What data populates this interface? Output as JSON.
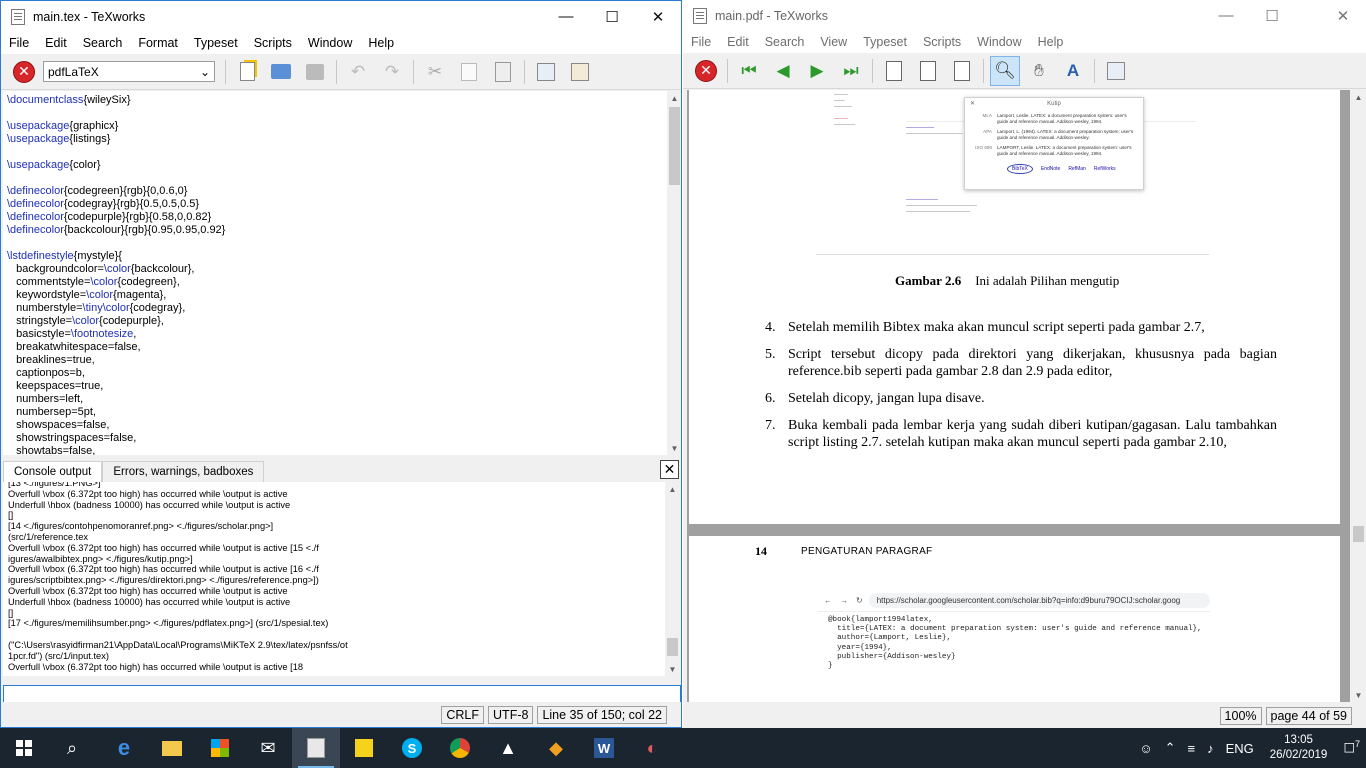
{
  "left_window": {
    "title": "main.tex - TeXworks",
    "menu": [
      "File",
      "Edit",
      "Search",
      "Format",
      "Typeset",
      "Scripts",
      "Window",
      "Help"
    ],
    "typeset_engine": "pdfLaTeX",
    "code_lines": [
      "\\documentclass{wileySix}",
      "",
      "\\usepackage{graphicx}",
      "\\usepackage{listings}",
      "",
      "\\usepackage{color}",
      "",
      "\\definecolor{codegreen}{rgb}{0,0.6,0}",
      "\\definecolor{codegray}{rgb}{0.5,0.5,0.5}",
      "\\definecolor{codepurple}{rgb}{0.58,0,0.82}",
      "\\definecolor{backcolour}{rgb}{0.95,0.95,0.92}",
      "",
      "\\lstdefinestyle{mystyle}{",
      "   backgroundcolor=\\color{backcolour},",
      "   commentstyle=\\color{codegreen},",
      "   keywordstyle=\\color{magenta},",
      "   numberstyle=\\tiny\\color{codegray},",
      "   stringstyle=\\color{codepurple},",
      "   basicstyle=\\footnotesize,",
      "   breakatwhitespace=false,",
      "   breaklines=true,",
      "   captionpos=b,",
      "   keepspaces=true,",
      "   numbers=left,",
      "   numbersep=5pt,",
      "   showspaces=false,",
      "   showstringspaces=false,",
      "   showtabs=false,"
    ],
    "tabs": {
      "console": "Console output",
      "errors": "Errors, warnings, badboxes"
    },
    "console_lines": [
      "[13 <./figures/1.PNG>]",
      "Overfull \\vbox (6.372pt too high) has occurred while \\output is active",
      "Underfull \\hbox (badness 10000) has occurred while \\output is active",
      "[]",
      "[14 <./figures/contohpenomoranref.png> <./figures/scholar.png>]",
      "(src/1/reference.tex",
      "Overfull \\vbox (6.372pt too high) has occurred while \\output is active [15 <./f",
      "igures/awalbibtex.png> <./figures/kutip.png>]",
      "Overfull \\vbox (6.372pt too high) has occurred while \\output is active [16 <./f",
      "igures/scriptbibtex.png> <./figures/direktori.png> <./figures/reference.png>])",
      "Overfull \\vbox (6.372pt too high) has occurred while \\output is active",
      "Underfull \\hbox (badness 10000) has occurred while \\output is active",
      "[]",
      "[17 <./figures/memilihsumber.png> <./figures/pdflatex.png>] (src/1/spesial.tex)",
      "",
      "(\"C:\\Users\\rasyidfirman21\\AppData\\Local\\Programs\\MiKTeX 2.9\\tex/latex/psnfss/ot",
      "1pcr.fd\") (src/1/input.tex)",
      "Overfull \\vbox (6.372pt too high) has occurred while \\output is active [18"
    ],
    "status": {
      "line_ending": "CRLF",
      "encoding": "UTF-8",
      "position": "Line 35 of 150; col 22"
    }
  },
  "right_window": {
    "title": "main.pdf - TeXworks",
    "menu": [
      "File",
      "Edit",
      "Search",
      "View",
      "Typeset",
      "Scripts",
      "Window",
      "Help"
    ],
    "figure_caption": {
      "label": "Gambar 2.6",
      "text": "Ini adalah Pilihan mengutip"
    },
    "list_items": [
      {
        "num": "4.",
        "text": "Setelah memilih Bibtex maka akan muncul script seperti pada gambar 2.7,"
      },
      {
        "num": "5.",
        "text": "Script tersebut dicopy pada direktori yang dikerjakan, khususnya pada bagian reference.bib seperti pada gambar 2.8 dan 2.9 pada editor,"
      },
      {
        "num": "6.",
        "text": "Setelah dicopy, jangan lupa disave."
      },
      {
        "num": "7.",
        "text": "Buka kembali pada lembar kerja yang sudah diberi kutipan/gagasan. Lalu tambahkan script listing 2.7. setelah kutipan maka akan muncul seperti pada gambar 2.10,"
      }
    ],
    "dialog": {
      "title": "Kutip",
      "rows": [
        {
          "style": "MLA",
          "text": "Lamport, Leslie. LATEX: a document preparation system: user's guide and reference manual. Addison-wesley, 1994."
        },
        {
          "style": "APA",
          "text": "Lamport, L. (1994). LATEX: a document preparation system: user's guide and reference manual. Addison-wesley."
        },
        {
          "style": "ISO 690",
          "text": "LAMPORT, Leslie. LATEX: a document preparation system: user's guide and reference manual. Addison-wesley, 1994."
        }
      ],
      "links": [
        "BibTeX",
        "EndNote",
        "RefMan",
        "RefWorks"
      ]
    },
    "page2": {
      "number": "14",
      "header": "PENGATURAN PARAGRAF",
      "url": "https://scholar.googleusercontent.com/scholar.bib?q=info:d9buru79OCIJ:scholar.goog",
      "bib_lines": [
        "@book{lamport1994latex,",
        "  title={LATEX: a document preparation system: user's guide and reference manual},",
        "  author={Lamport, Leslie},",
        "  year={1994},",
        "  publisher={Addison-wesley}",
        "}"
      ]
    },
    "status": {
      "zoom": "100%",
      "page": "page 44 of 59"
    }
  },
  "taskbar": {
    "language": "ENG",
    "time": "13:05",
    "date": "26/02/2019",
    "notifications": "7"
  }
}
